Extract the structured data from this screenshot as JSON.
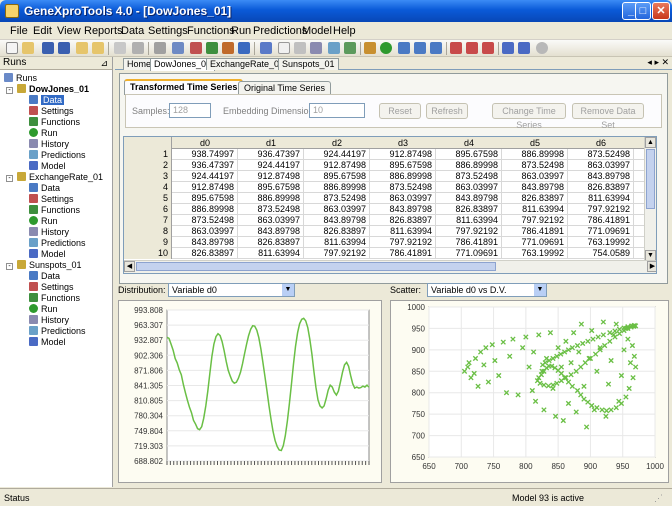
{
  "window": {
    "title": "GeneXproTools 4.0 - [DowJones_01]"
  },
  "menu": [
    "File",
    "Edit",
    "View",
    "Reports",
    "Data",
    "Settings",
    "Functions",
    "Run",
    "Predictions",
    "Model",
    "Help"
  ],
  "sidebar": {
    "header": "Runs",
    "root": "Runs",
    "runs": [
      {
        "name": "DowJones_01",
        "items": [
          "Data",
          "Settings",
          "Functions",
          "Run",
          "History",
          "Predictions",
          "Model"
        ]
      },
      {
        "name": "ExchangeRate_01",
        "items": [
          "Data",
          "Settings",
          "Functions",
          "Run",
          "History",
          "Predictions",
          "Model"
        ]
      },
      {
        "name": "Sunspots_01",
        "items": [
          "Data",
          "Settings",
          "Functions",
          "Run",
          "History",
          "Predictions",
          "Model"
        ]
      }
    ]
  },
  "doc_tabs": [
    "Home",
    "DowJones_01",
    "ExchangeRate_01",
    "Sunspots_01"
  ],
  "inner_tabs": [
    "Transformed Time Series",
    "Original Time Series"
  ],
  "controls": {
    "samples_label": "Samples:",
    "samples_value": "128",
    "embedding_label": "Embedding Dimension:",
    "embedding_value": "10",
    "reset": "Reset",
    "refresh": "Refresh",
    "change": "Change Time Series",
    "remove": "Remove Data Set"
  },
  "table": {
    "columns": [
      "d0",
      "d1",
      "d2",
      "d3",
      "d4",
      "d5",
      "d6"
    ],
    "rows": [
      [
        "1",
        "938.74997",
        "936.47397",
        "924.44197",
        "912.87498",
        "895.67598",
        "886.89998",
        "873.52498"
      ],
      [
        "2",
        "936.47397",
        "924.44197",
        "912.87498",
        "895.67598",
        "886.89998",
        "873.52498",
        "863.03997"
      ],
      [
        "3",
        "924.44197",
        "912.87498",
        "895.67598",
        "886.89998",
        "873.52498",
        "863.03997",
        "843.89798"
      ],
      [
        "4",
        "912.87498",
        "895.67598",
        "886.89998",
        "873.52498",
        "863.03997",
        "843.89798",
        "826.83897"
      ],
      [
        "5",
        "895.67598",
        "886.89998",
        "873.52498",
        "863.03997",
        "843.89798",
        "826.83897",
        "811.63994"
      ],
      [
        "6",
        "886.89998",
        "873.52498",
        "863.03997",
        "843.89798",
        "826.83897",
        "811.63994",
        "797.92192"
      ],
      [
        "7",
        "873.52498",
        "863.03997",
        "843.89798",
        "826.83897",
        "811.63994",
        "797.92192",
        "786.41891"
      ],
      [
        "8",
        "863.03997",
        "843.89798",
        "826.83897",
        "811.63994",
        "797.92192",
        "786.41891",
        "771.09691"
      ],
      [
        "9",
        "843.89798",
        "826.83897",
        "811.63994",
        "797.92192",
        "786.41891",
        "771.09691",
        "763.19992"
      ],
      [
        "10",
        "826.83897",
        "811.63994",
        "797.92192",
        "786.41891",
        "771.09691",
        "763.19992",
        "754.0589"
      ]
    ]
  },
  "distribution": {
    "label": "Distribution:",
    "selected": "Variable d0"
  },
  "scatter": {
    "label": "Scatter:",
    "selected": "Variable d0 vs D.V."
  },
  "chart_data": [
    {
      "type": "line",
      "yticks": [
        "993.808",
        "963.307",
        "932.807",
        "902.306",
        "871.806",
        "841.305",
        "810.805",
        "780.304",
        "749.804",
        "719.303",
        "688.802"
      ],
      "ylim": [
        688.802,
        993.808
      ],
      "values": [
        938.75,
        936.47,
        924.44,
        912.87,
        895.68,
        886.9,
        873.52,
        863.04,
        843.9,
        826.84,
        811.64,
        797.92,
        786.42,
        771.1,
        763.2,
        754.06,
        752,
        758,
        775,
        800,
        830,
        865,
        900,
        925,
        940,
        946,
        942,
        930,
        912,
        890,
        872,
        860,
        850,
        846,
        848,
        856,
        868,
        885,
        905,
        925,
        942,
        955,
        962,
        961,
        953,
        938,
        915,
        888,
        860,
        830,
        800,
        772,
        748,
        730,
        718,
        711,
        710,
        720,
        740,
        770,
        805,
        845,
        885,
        920,
        948,
        966,
        975,
        977,
        972,
        958,
        935,
        905,
        870,
        838,
        812,
        800,
        796,
        800,
        815,
        832,
        842,
        838,
        828,
        822,
        830,
        848,
        868,
        883,
        888,
        880,
        862,
        845,
        836,
        838,
        836,
        837,
        840,
        838,
        842,
        838
      ]
    },
    {
      "type": "scatter",
      "xticks": [
        "650",
        "700",
        "750",
        "800",
        "850",
        "900",
        "950",
        "1000"
      ],
      "yticks": [
        "650",
        "700",
        "750",
        "800",
        "850",
        "900",
        "950",
        "1000"
      ],
      "xlim": [
        650,
        1000
      ],
      "ylim": [
        650,
        1000
      ],
      "x": [
        705,
        710,
        712,
        715,
        720,
        722,
        726,
        730,
        735,
        738,
        742,
        748,
        752,
        758,
        765,
        770,
        775,
        780,
        788,
        795,
        800,
        805,
        810,
        812,
        815,
        820,
        825,
        828,
        832,
        838,
        842,
        846,
        850,
        855,
        858,
        862,
        866,
        870,
        874,
        878,
        882,
        886,
        890,
        894,
        898,
        902,
        906,
        910,
        915,
        920,
        924,
        928,
        932,
        936,
        940,
        944,
        948,
        952,
        955,
        958,
        962,
        965,
        968,
        970,
        966,
        960,
        955,
        948,
        940,
        932,
        925,
        918,
        910,
        902,
        896,
        890,
        885,
        880,
        872,
        866,
        860,
        855,
        850,
        845,
        840,
        836,
        832,
        828,
        824,
        820,
        818,
        822,
        828,
        835,
        842,
        848,
        855,
        862,
        870,
        878,
        885,
        892,
        900,
        908,
        915,
        922,
        930,
        938,
        945,
        952,
        958,
        963,
        967,
        970,
        968,
        964,
        958,
        952,
        945,
        938,
        930,
        920,
        912,
        904,
        896,
        888,
        880,
        872,
        866,
        860,
        854,
        848,
        842,
        836,
        830,
        826
      ],
      "y": [
        850,
        860,
        870,
        835,
        845,
        880,
        815,
        895,
        865,
        905,
        825,
        912,
        875,
        840,
        918,
        800,
        885,
        925,
        795,
        905,
        930,
        860,
        805,
        895,
        780,
        935,
        850,
        760,
        880,
        940,
        810,
        745,
        905,
        860,
        735,
        920,
        775,
        870,
        940,
        755,
        895,
        960,
        815,
        720,
        880,
        945,
        760,
        850,
        905,
        965,
        745,
        820,
        875,
        935,
        960,
        780,
        840,
        900,
        950,
        925,
        870,
        910,
        885,
        860,
        835,
        810,
        790,
        775,
        765,
        760,
        758,
        760,
        765,
        770,
        778,
        785,
        795,
        805,
        815,
        825,
        835,
        845,
        852,
        858,
        862,
        862,
        858,
        850,
        842,
        835,
        828,
        822,
        818,
        816,
        818,
        822,
        828,
        835,
        842,
        850,
        860,
        870,
        880,
        890,
        900,
        910,
        920,
        930,
        938,
        945,
        950,
        953,
        955,
        956,
        957,
        956,
        954,
        951,
        948,
        944,
        940,
        935,
        930,
        925,
        920,
        915,
        910,
        905,
        900,
        895,
        890,
        885,
        880,
        875,
        870,
        865
      ]
    }
  ],
  "status": {
    "left": "Status",
    "right": "Model 93 is active"
  }
}
